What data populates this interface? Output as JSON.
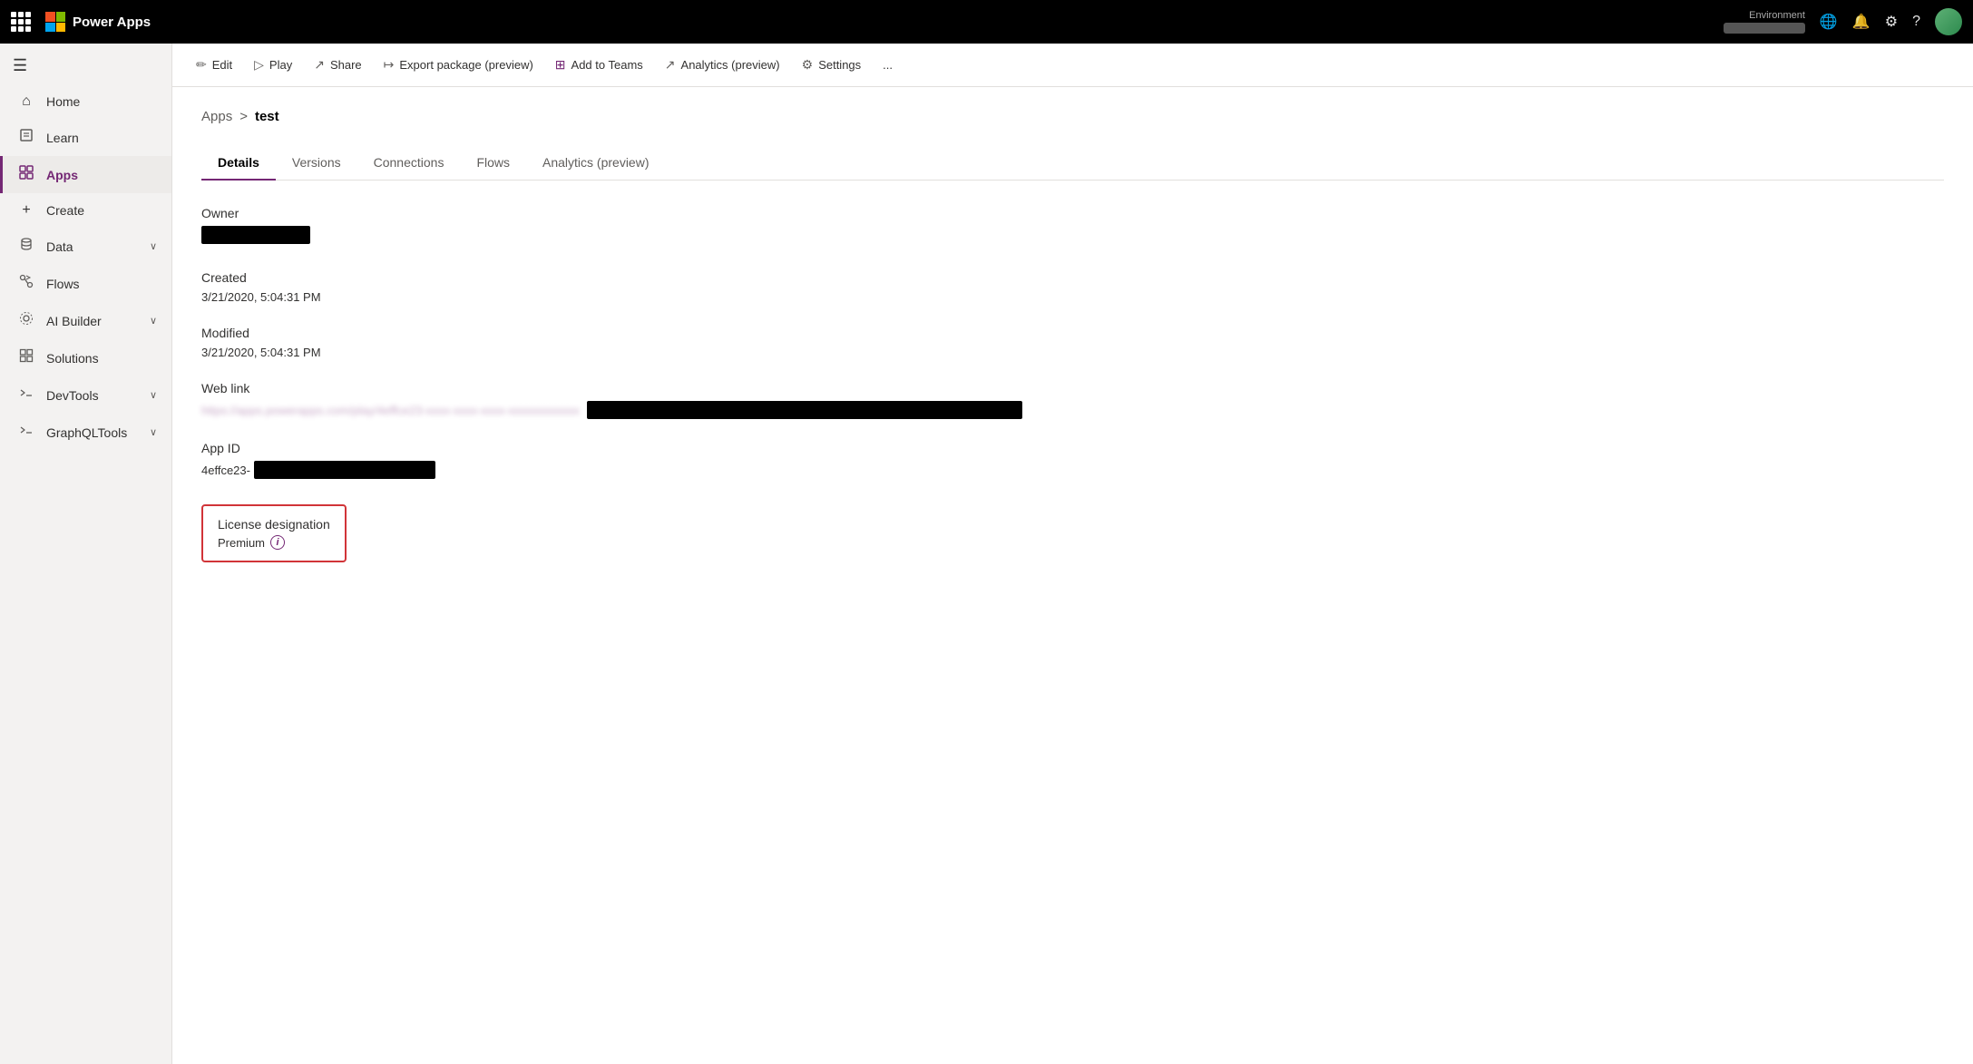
{
  "topnav": {
    "brand": "Power Apps",
    "environment_label": "Environment",
    "env_display": "Environment"
  },
  "toolbar": {
    "edit": "Edit",
    "play": "Play",
    "share": "Share",
    "export": "Export package (preview)",
    "add_to_teams": "Add to Teams",
    "analytics": "Analytics (preview)",
    "settings": "Settings",
    "more": "..."
  },
  "breadcrumb": {
    "parent": "Apps",
    "separator": ">",
    "current": "test"
  },
  "tabs": [
    {
      "label": "Details",
      "active": true
    },
    {
      "label": "Versions",
      "active": false
    },
    {
      "label": "Connections",
      "active": false
    },
    {
      "label": "Flows",
      "active": false
    },
    {
      "label": "Analytics (preview)",
      "active": false
    }
  ],
  "fields": {
    "owner_label": "Owner",
    "created_label": "Created",
    "created_value": "3/21/2020, 5:04:31 PM",
    "modified_label": "Modified",
    "modified_value": "3/21/2020, 5:04:31 PM",
    "weblink_label": "Web link",
    "weblink_blurred": "https://apps.powerapps.com/play/4effce23-xxxx-xxxx-xxxx-xxxxxxxxxxxx",
    "appid_label": "App ID",
    "appid_prefix": "4effce23-",
    "license_label": "License designation",
    "license_value": "Premium"
  },
  "sidebar": {
    "items": [
      {
        "label": "Home",
        "icon": "⌂",
        "active": false,
        "has_chevron": false
      },
      {
        "label": "Learn",
        "icon": "📖",
        "active": false,
        "has_chevron": false
      },
      {
        "label": "Apps",
        "icon": "⊞",
        "active": true,
        "has_chevron": false
      },
      {
        "label": "Create",
        "icon": "+",
        "active": false,
        "has_chevron": false
      },
      {
        "label": "Data",
        "icon": "⊞",
        "active": false,
        "has_chevron": true
      },
      {
        "label": "Flows",
        "icon": "⇌",
        "active": false,
        "has_chevron": false
      },
      {
        "label": "AI Builder",
        "icon": "⊙",
        "active": false,
        "has_chevron": true
      },
      {
        "label": "Solutions",
        "icon": "▦",
        "active": false,
        "has_chevron": false
      },
      {
        "label": "DevTools",
        "icon": "⚙",
        "active": false,
        "has_chevron": true
      },
      {
        "label": "GraphQLTools",
        "icon": "⚙",
        "active": false,
        "has_chevron": true
      }
    ]
  }
}
